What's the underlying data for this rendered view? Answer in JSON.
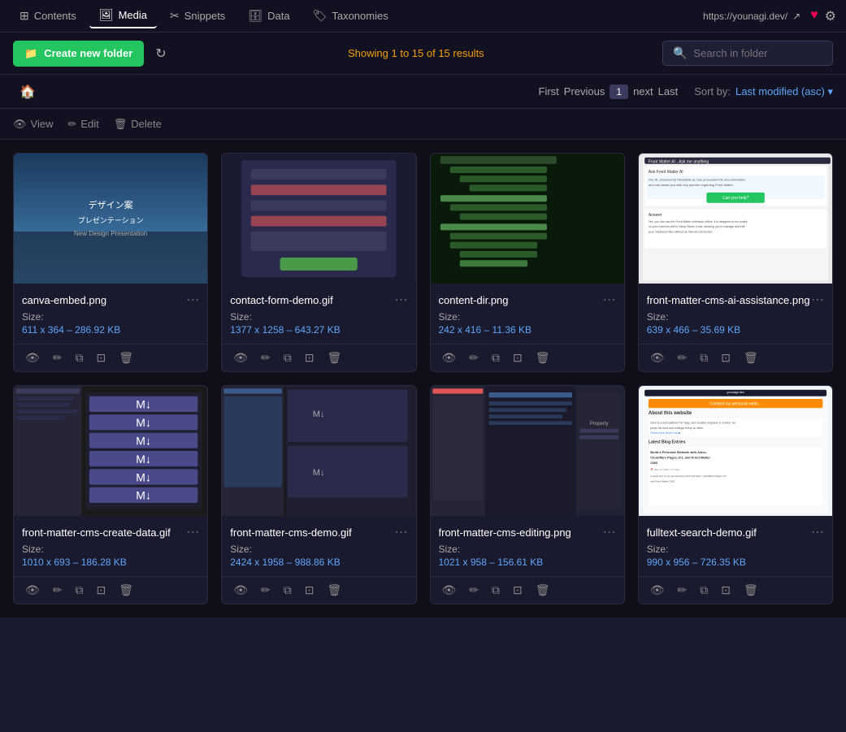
{
  "nav": {
    "tabs": [
      {
        "id": "contents",
        "label": "Contents",
        "icon": "⊞",
        "active": false
      },
      {
        "id": "media",
        "label": "Media",
        "icon": "🖼",
        "active": true
      },
      {
        "id": "snippets",
        "label": "Snippets",
        "icon": "✂",
        "active": false
      },
      {
        "id": "data",
        "label": "Data",
        "icon": "🗄",
        "active": false
      },
      {
        "id": "taxonomies",
        "label": "Taxonomies",
        "icon": "🏷",
        "active": false
      }
    ],
    "url": "https://younagi.dev/",
    "heart_icon": "♥",
    "settings_icon": "⚙"
  },
  "toolbar": {
    "create_label": "Create new folder",
    "refresh_icon": "↻",
    "showing_text": "Showing 1 to 15 of 15 results",
    "search_placeholder": "Search in folder"
  },
  "pagination": {
    "first_label": "First",
    "previous_label": "Previous",
    "page_num": "1",
    "next_label": "next",
    "last_label": "Last",
    "sort_by_label": "Sort by:",
    "sort_value": "Last modified (asc)",
    "sort_icon": "▾"
  },
  "actions": {
    "view_label": "View",
    "edit_label": "Edit",
    "delete_label": "Delete"
  },
  "media_items": [
    {
      "id": "canva-embed",
      "name": "canva-embed.png",
      "size_label": "Size:",
      "size_value": "611 x 364 – 286.92 KB",
      "thumb_type": "canva"
    },
    {
      "id": "contact-form-demo",
      "name": "contact-form-demo.gif",
      "size_label": "Size:",
      "size_value": "1377 x 1258 – 643.27 KB",
      "thumb_type": "contact"
    },
    {
      "id": "content-dir",
      "name": "content-dir.png",
      "size_label": "Size:",
      "size_value": "242 x 416 – 11.36 KB",
      "thumb_type": "content"
    },
    {
      "id": "front-matter-cms-ai",
      "name": "front-matter-cms-ai-assistance.png",
      "size_label": "Size:",
      "size_value": "639 x 466 – 35.69 KB",
      "thumb_type": "fm-ai"
    },
    {
      "id": "fm-create-data",
      "name": "front-matter-cms-create-data.gif",
      "size_label": "Size:",
      "size_value": "1010 x 693 – 186.28 KB",
      "thumb_type": "fm-create"
    },
    {
      "id": "fm-demo",
      "name": "front-matter-cms-demo.gif",
      "size_label": "Size:",
      "size_value": "2424 x 1958 – 988.86 KB",
      "thumb_type": "fm-demo"
    },
    {
      "id": "fm-editing",
      "name": "front-matter-cms-editing.png",
      "size_label": "Size:",
      "size_value": "1021 x 958 – 156.61 KB",
      "thumb_type": "fm-editing"
    },
    {
      "id": "fulltext-search-demo",
      "name": "fulltext-search-demo.gif",
      "size_label": "Size:",
      "size_value": "990 x 956 – 726.35 KB",
      "thumb_type": "fulltext"
    }
  ],
  "icon_labels": {
    "view": "👁",
    "edit": "✏",
    "copy": "⧉",
    "terminal": "⊡",
    "delete": "🗑",
    "more": "⋯"
  }
}
